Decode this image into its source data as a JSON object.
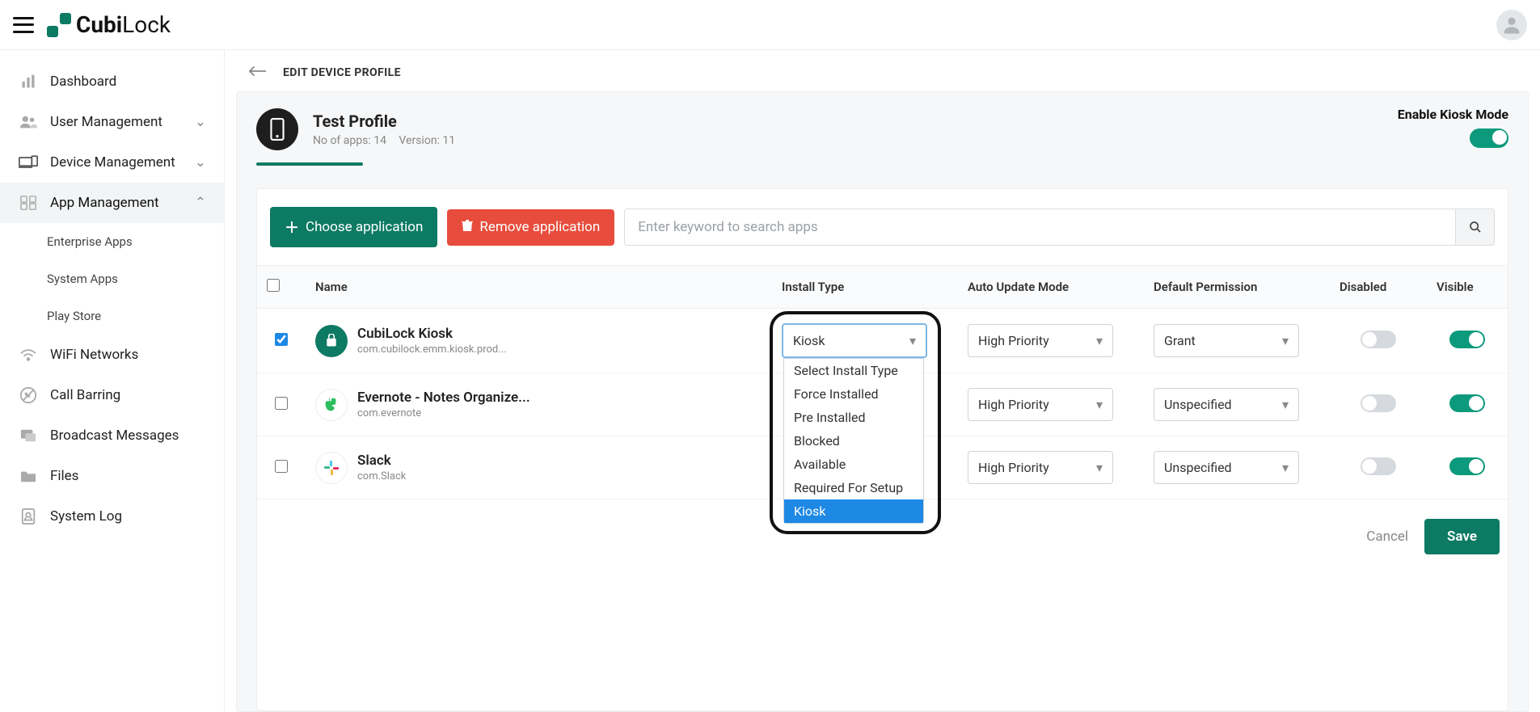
{
  "logo": {
    "part1": "Cubi",
    "part2": "Lock"
  },
  "sidebar": {
    "items": [
      {
        "label": "Dashboard"
      },
      {
        "label": "User Management"
      },
      {
        "label": "Device Management"
      },
      {
        "label": "App Management"
      },
      {
        "label": "WiFi Networks"
      },
      {
        "label": "Call Barring"
      },
      {
        "label": "Broadcast Messages"
      },
      {
        "label": "Files"
      },
      {
        "label": "System Log"
      }
    ],
    "sub": [
      {
        "label": "Enterprise Apps"
      },
      {
        "label": "System Apps"
      },
      {
        "label": "Play Store"
      }
    ]
  },
  "breadcrumb": "EDIT DEVICE PROFILE",
  "profile": {
    "title": "Test Profile",
    "apps_label": "No of apps: 14",
    "version_label": "Version: 11",
    "kiosk_label": "Enable Kiosk Mode"
  },
  "toolbar": {
    "choose": "Choose application",
    "remove": "Remove application",
    "search_placeholder": "Enter keyword to search apps"
  },
  "table": {
    "headers": {
      "name": "Name",
      "install": "Install Type",
      "update": "Auto Update Mode",
      "perm": "Default Permission",
      "disabled": "Disabled",
      "visible": "Visible"
    },
    "rows": [
      {
        "checked": true,
        "name": "CubiLock Kiosk",
        "pkg": "com.cubilock.emm.kiosk.prod...",
        "install": "Kiosk",
        "update": "High Priority",
        "perm": "Grant"
      },
      {
        "checked": false,
        "name": "Evernote - Notes Organize...",
        "pkg": "com.evernote",
        "install": "",
        "update": "High Priority",
        "perm": "Unspecified"
      },
      {
        "checked": false,
        "name": "Slack",
        "pkg": "com.Slack",
        "install": "",
        "update": "High Priority",
        "perm": "Unspecified"
      }
    ],
    "install_options": [
      "Select Install Type",
      "Force Installed",
      "Pre Installed",
      "Blocked",
      "Available",
      "Required For Setup",
      "Kiosk"
    ]
  },
  "footer": {
    "cancel": "Cancel",
    "save": "Save"
  }
}
